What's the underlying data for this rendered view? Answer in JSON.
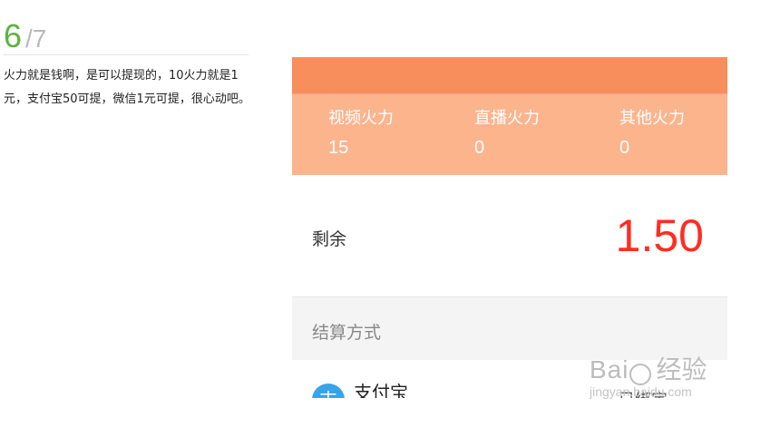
{
  "step": {
    "current": "6",
    "total_text": "/7",
    "description": "火力就是钱啊，是可以提现的，10火力就是1元，支付宝50可提，微信1元可提，很心动吧。"
  },
  "app": {
    "stats": [
      {
        "label": "视频火力",
        "value": "15"
      },
      {
        "label": "直播火力",
        "value": "0"
      },
      {
        "label": "其他火力",
        "value": "0"
      }
    ],
    "remain_label": "剩余",
    "remain_value": "1.50",
    "settlement_title": "结算方式",
    "payment": {
      "icon_char": "支",
      "name": "支付宝",
      "extra": "已绑定"
    }
  },
  "watermark": {
    "logo_left": "Bai",
    "logo_right": "经验",
    "url": "jingyan.baidu.com"
  },
  "colors": {
    "step_current": "#5cb23d",
    "top_bar": "#f98e5d",
    "stats_bg": "#fcb48d",
    "remain_value": "#ff2d21",
    "alipay": "#3aa3e8"
  }
}
